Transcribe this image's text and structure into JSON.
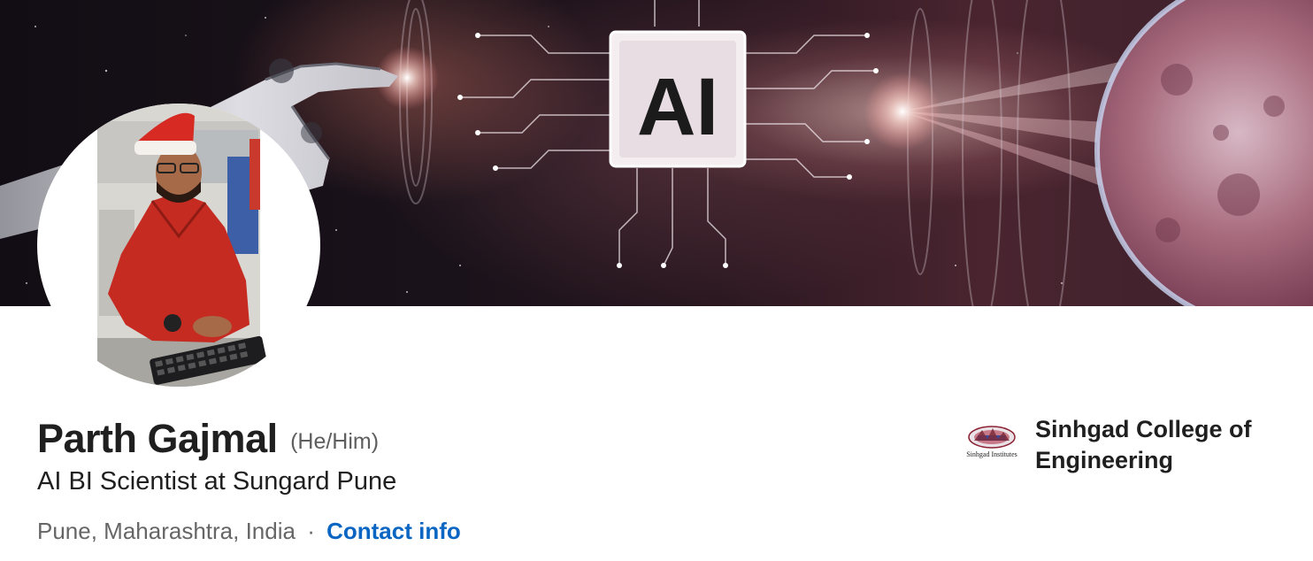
{
  "profile": {
    "name": "Parth Gajmal",
    "pronouns": "(He/Him)",
    "headline": "AI BI Scientist at Sungard Pune",
    "location": "Pune, Maharashtra, India",
    "separator": "·",
    "contact_info_label": "Contact info"
  },
  "banner": {
    "ai_badge_text": "AI",
    "icon": "ai-banner-image"
  },
  "education": {
    "school_name": "Sinhgad College of Engineering",
    "logo_caption": "Sinhgad Institutes"
  },
  "colors": {
    "link": "#0a66c2",
    "name_text": "#1f1f1f",
    "secondary_text": "#666666"
  }
}
